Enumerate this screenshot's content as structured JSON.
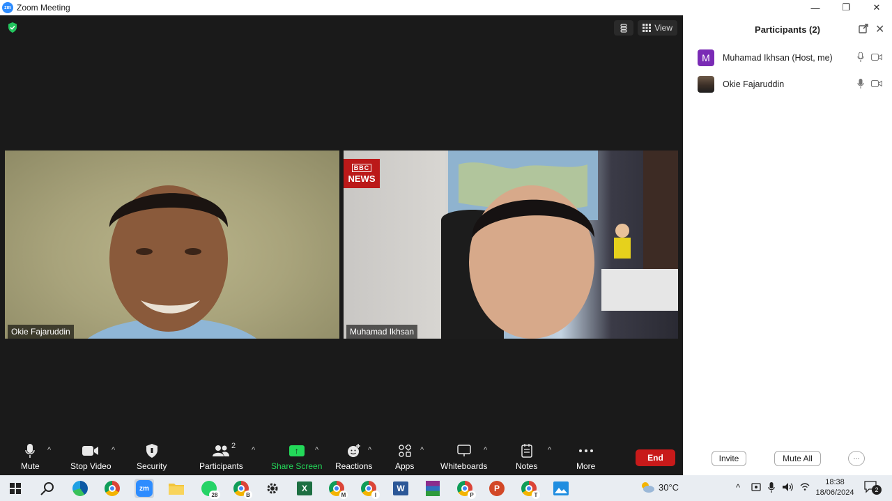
{
  "window": {
    "logo_text": "zm",
    "title": "Zoom Meeting",
    "minimize": "—",
    "restore": "❐",
    "close": "✕"
  },
  "meeting": {
    "view_label": "View",
    "tiles": [
      {
        "name": "Okie Fajaruddin"
      },
      {
        "name": "Muhamad Ikhsan",
        "overlay_top": "BBC",
        "overlay_bottom": "NEWS"
      }
    ]
  },
  "toolbar": {
    "mute": "Mute",
    "stop_video": "Stop Video",
    "security": "Security",
    "participants": "Participants",
    "participants_count": "2",
    "share_screen": "Share Screen",
    "reactions": "Reactions",
    "apps": "Apps",
    "whiteboards": "Whiteboards",
    "notes": "Notes",
    "more": "More",
    "end": "End",
    "share_color": "#23d959",
    "end_color": "#c81a1a"
  },
  "participants_panel": {
    "title": "Participants (2)",
    "list": [
      {
        "avatar": "M",
        "name": "Muhamad Ikhsan (Host, me)"
      },
      {
        "avatar": "",
        "name": "Okie Fajaruddin"
      }
    ],
    "invite": "Invite",
    "mute_all": "Mute All",
    "more": "···"
  },
  "taskbar": {
    "zoom_label": "zm",
    "whatsapp_count": "28",
    "chrome_profiles": [
      "",
      "B",
      "M",
      "I",
      "P",
      "T"
    ],
    "excel": "X",
    "word": "W",
    "powerpoint": "P",
    "weather": "30°C",
    "time": "18:38",
    "date": "18/06/2024",
    "notifications": "2"
  }
}
